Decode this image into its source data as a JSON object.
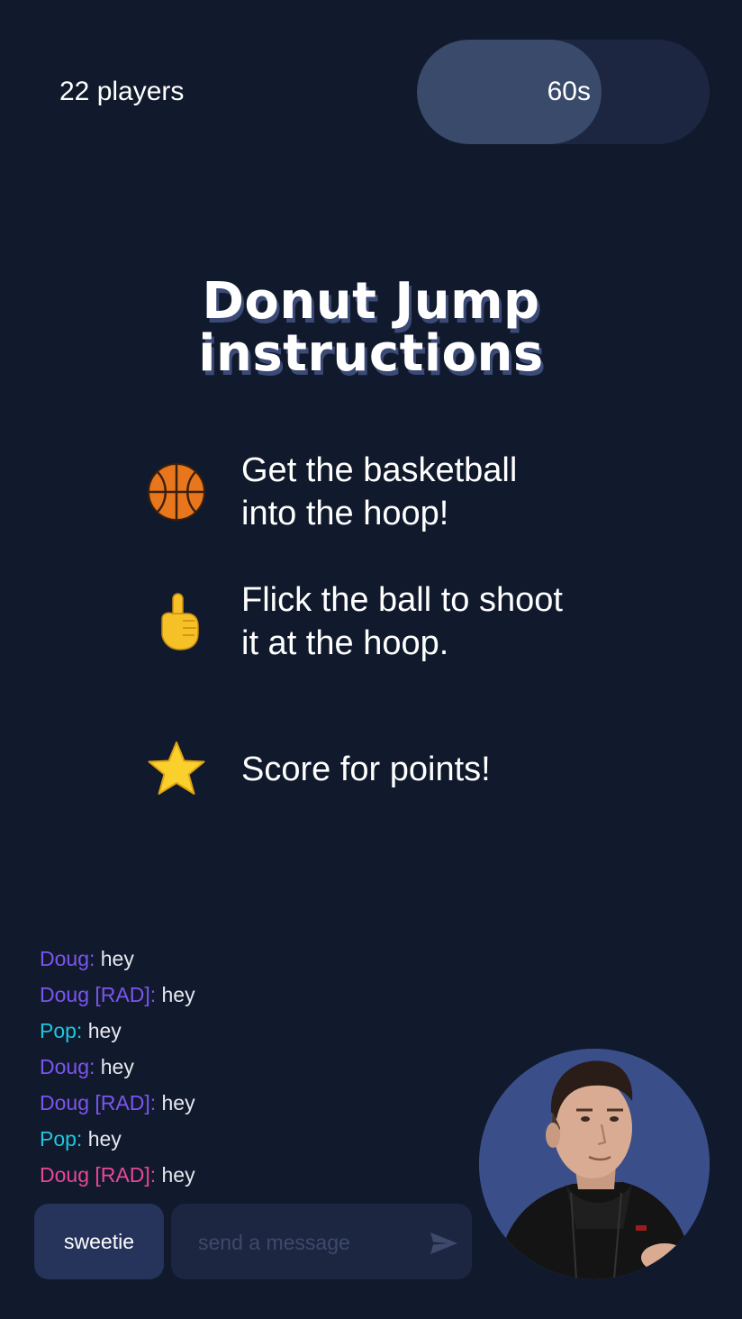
{
  "header": {
    "players_label": "22 players",
    "timer_label": "60s",
    "timer_progress": 0.63
  },
  "title": {
    "line1": "Donut Jump",
    "line2": "instructions"
  },
  "instructions": [
    {
      "icon": "basketball-icon",
      "line1": "Get the basketball",
      "line2": "into the hoop!"
    },
    {
      "icon": "pointing-finger-icon",
      "line1": "Flick the ball to shoot",
      "line2": "it at the hoop."
    },
    {
      "icon": "star-icon",
      "line1": "Score for points!",
      "line2": ""
    }
  ],
  "chat": {
    "messages": [
      {
        "user": "Doug:",
        "text": "hey",
        "color": "#7b55f0"
      },
      {
        "user": "Doug [RAD]:",
        "text": "hey",
        "color": "#7b55f0"
      },
      {
        "user": "Pop:",
        "text": "hey",
        "color": "#1fc6e0"
      },
      {
        "user": "Doug:",
        "text": "hey",
        "color": "#7b55f0"
      },
      {
        "user": "Doug [RAD]:",
        "text": "hey",
        "color": "#7b55f0"
      },
      {
        "user": "Pop:",
        "text": "hey",
        "color": "#1fc6e0"
      },
      {
        "user": "Doug [RAD]:",
        "text": "hey",
        "color": "#e8479a"
      }
    ],
    "name_button": "sweetie",
    "input_placeholder": "send a message",
    "send_icon": "send-icon"
  },
  "avatar": {
    "icon": "user-avatar",
    "background": "#3a4e8a"
  },
  "colors": {
    "background": "#111a2c",
    "timer_track": "#1c2641",
    "timer_fill": "#3a4a6b",
    "title_shadow": "#3b4a76"
  }
}
